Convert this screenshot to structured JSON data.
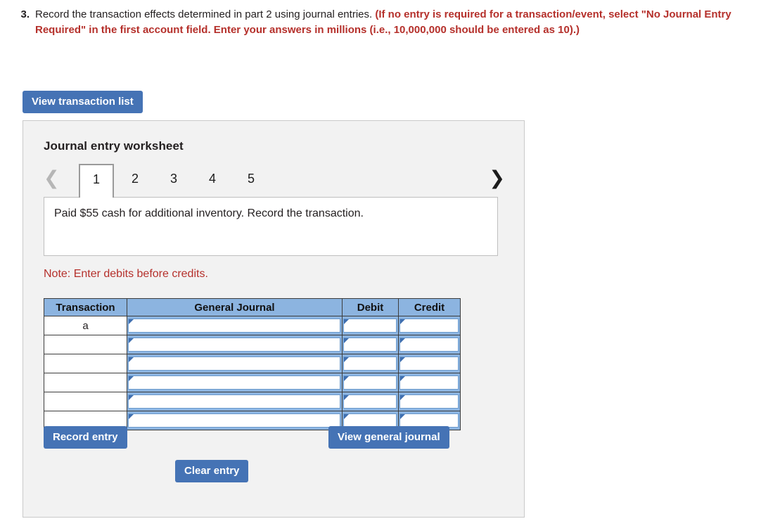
{
  "question": {
    "number": "3.",
    "text_plain": "Record the transaction effects determined in part 2 using journal entries. ",
    "text_emphasis": "(If no entry is required for a transaction/event, select \"No Journal Entry Required\" in the first account field. Enter your answers in millions (i.e., 10,000,000 should be entered as 10).)",
    "emphasis_color": "#b5302b"
  },
  "toolbar": {
    "view_transaction_list_label": "View transaction list"
  },
  "worksheet": {
    "title": "Journal entry worksheet",
    "prev_icon": "chevron-left-icon",
    "next_icon": "chevron-right-icon",
    "prev_enabled": false,
    "next_enabled": true,
    "tabs": [
      {
        "label": "1",
        "active": true
      },
      {
        "label": "2",
        "active": false
      },
      {
        "label": "3",
        "active": false
      },
      {
        "label": "4",
        "active": false
      },
      {
        "label": "5",
        "active": false
      }
    ],
    "description": "Paid $55 cash for additional inventory. Record the transaction.",
    "note": "Note: Enter debits before credits.",
    "accent_blue": "#4573b5",
    "header_blue": "#8cb4e0"
  },
  "journal_table": {
    "columns": [
      "Transaction",
      "General Journal",
      "Debit",
      "Credit"
    ],
    "rows": [
      {
        "transaction": "a",
        "general_journal": "",
        "debit": "",
        "credit": ""
      },
      {
        "transaction": "",
        "general_journal": "",
        "debit": "",
        "credit": ""
      },
      {
        "transaction": "",
        "general_journal": "",
        "debit": "",
        "credit": ""
      },
      {
        "transaction": "",
        "general_journal": "",
        "debit": "",
        "credit": ""
      },
      {
        "transaction": "",
        "general_journal": "",
        "debit": "",
        "credit": ""
      },
      {
        "transaction": "",
        "general_journal": "",
        "debit": "",
        "credit": ""
      }
    ]
  },
  "actions": {
    "record_entry_label": "Record entry",
    "clear_entry_label": "Clear entry",
    "view_general_journal_label": "View general journal"
  }
}
